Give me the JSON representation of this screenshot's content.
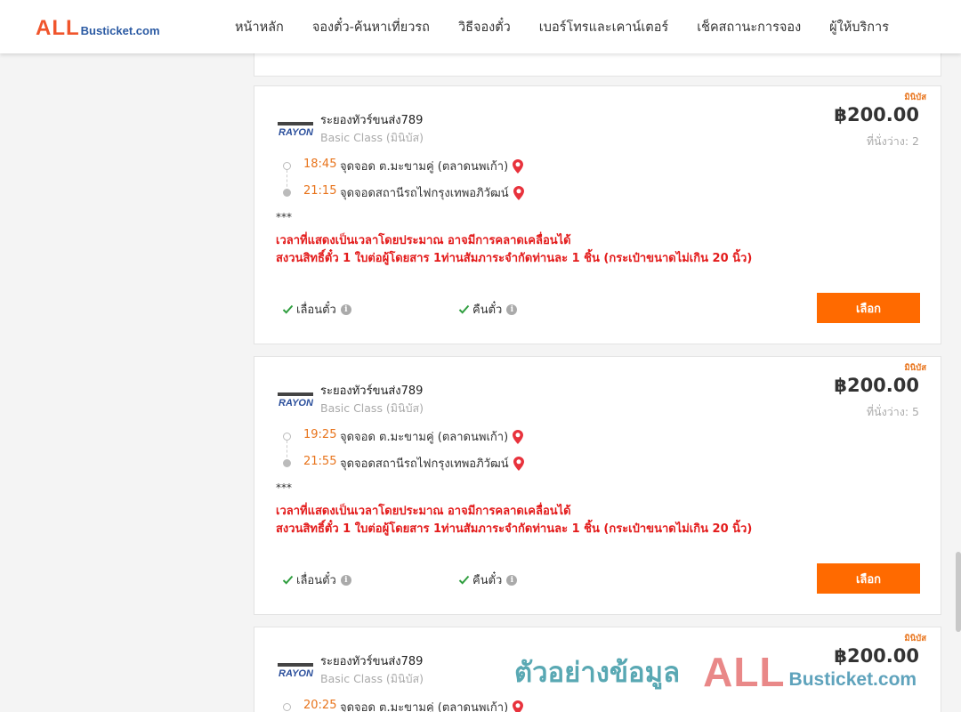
{
  "header": {
    "logo_accent": "ALL",
    "logo_rest": "Busticket.com",
    "nav": [
      {
        "label": "หน้าหลัก"
      },
      {
        "label": "จองตั๋ว-ค้นหาเที่ยวรถ"
      },
      {
        "label": "วิธีจองตั๋ว"
      },
      {
        "label": "เบอร์โทรและเคาน์เตอร์"
      },
      {
        "label": "เช็คสถานะการจอง"
      },
      {
        "label": "ผู้ให้บริการ"
      }
    ]
  },
  "trips": [
    {
      "badge": "มินิบัส",
      "operator": "ระยองทัวร์ขนส่ง789",
      "bus_class": "Basic Class (มินิบัส)",
      "price": "฿200.00",
      "seats_label": "ที่นั่งว่าง:",
      "seats_count": "2",
      "departure": {
        "time": "18:45",
        "stop": "จุดจอด ต.มะขามคู่ (ตลาดนพเก้า)"
      },
      "arrival": {
        "time": "21:15",
        "stop": "จุดจอดสถานีรถไฟกรุงเทพอภิวัฒน์"
      },
      "note_stars": "***",
      "note_1": "เวลาที่แสดงเป็นเวลาโดยประมาณ อาจมีการคลาดเคลื่อนได้",
      "note_2": "สงวนสิทธิ์ตั๋ว 1 ใบต่อผู้โดยสาร 1ท่านสัมภาระจำกัดท่านละ 1 ชิ้น (กระเป๋าขนาดไม่เกิน 20 นิ้ว)",
      "feature_1": "เลื่อนตั๋ว",
      "feature_2": "คืนตั๋ว",
      "select_label": "เลือก"
    },
    {
      "badge": "มินิบัส",
      "operator": "ระยองทัวร์ขนส่ง789",
      "bus_class": "Basic Class (มินิบัส)",
      "price": "฿200.00",
      "seats_label": "ที่นั่งว่าง:",
      "seats_count": "5",
      "departure": {
        "time": "19:25",
        "stop": "จุดจอด ต.มะขามคู่ (ตลาดนพเก้า)"
      },
      "arrival": {
        "time": "21:55",
        "stop": "จุดจอดสถานีรถไฟกรุงเทพอภิวัฒน์"
      },
      "note_stars": "***",
      "note_1": "เวลาที่แสดงเป็นเวลาโดยประมาณ อาจมีการคลาดเคลื่อนได้",
      "note_2": "สงวนสิทธิ์ตั๋ว 1 ใบต่อผู้โดยสาร 1ท่านสัมภาระจำกัดท่านละ 1 ชิ้น (กระเป๋าขนาดไม่เกิน 20 นิ้ว)",
      "feature_1": "เลื่อนตั๋ว",
      "feature_2": "คืนตั๋ว",
      "select_label": "เลือก"
    },
    {
      "badge": "มินิบัส",
      "operator": "ระยองทัวร์ขนส่ง789",
      "bus_class": "Basic Class (มินิบัส)",
      "price": "฿200.00",
      "departure": {
        "time": "20:25",
        "stop": "จุดจอด ต.มะขามคู่ (ตลาดนพเก้า)"
      }
    }
  ],
  "watermark": {
    "text": "ตัวอย่างข้อมูล",
    "logo_accent": "ALL",
    "logo_rest": "Busticket.com"
  },
  "colors": {
    "accent_orange": "#ff6a00",
    "time_orange": "#e8741c",
    "notice_red": "#e31b1b",
    "logo_red": "#f0552c",
    "logo_blue": "#2b5aa3"
  },
  "icons": {
    "pin": "location-pin-icon",
    "check": "check-icon",
    "info": "info-icon",
    "operator_logo": "rayong-logo-icon"
  }
}
